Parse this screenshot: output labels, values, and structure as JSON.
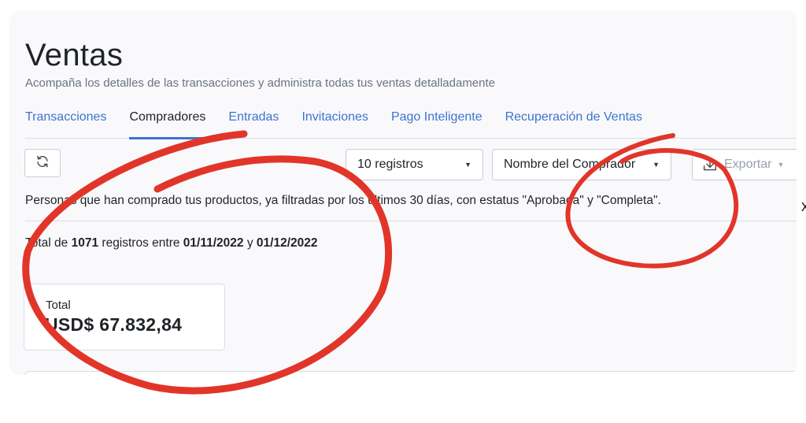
{
  "header": {
    "title": "Ventas",
    "subtitle": "Acompaña los detalles de las transacciones y administra todas tus ventas detalladamente"
  },
  "tabs": [
    {
      "label": "Transacciones",
      "active": false
    },
    {
      "label": "Compradores",
      "active": true
    },
    {
      "label": "Entradas",
      "active": false
    },
    {
      "label": "Invitaciones",
      "active": false
    },
    {
      "label": "Pago Inteligente",
      "active": false
    },
    {
      "label": "Recuperación de Ventas",
      "active": false
    }
  ],
  "toolbar": {
    "refresh_icon": "refresh-icon",
    "records_select": "10 registros",
    "sort_select": "Nombre del Comprador",
    "export_label": "Exportar",
    "export_icon": "download-icon"
  },
  "description": "Personas que han comprado tus productos, ya filtradas por los últimos 30 días, con estatus \"Aprobada\" y \"Completa\".",
  "summary": {
    "prefix": "Total de",
    "count": "1071",
    "middle": "registros entre",
    "start_date": "01/11/2022",
    "conjunction": "y",
    "end_date": "01/12/2022"
  },
  "card": {
    "label": "Total",
    "value": "USD$ 67.832,84"
  },
  "edge_glyph": "x",
  "colors": {
    "accent": "#3d73cf",
    "annotation": "#e2352a",
    "panel": "#f9f9fb"
  }
}
